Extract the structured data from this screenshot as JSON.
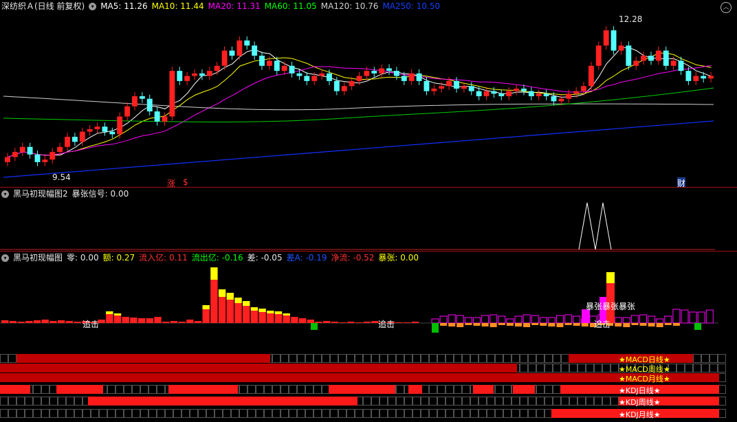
{
  "main": {
    "title": "深纺织Ａ(日线 前复权)",
    "ma": [
      {
        "label": "MA5: 11.26",
        "color": "#ffffff"
      },
      {
        "label": "MA10: 11.44",
        "color": "#ffff00"
      },
      {
        "label": "MA20: 11.31",
        "color": "#ff00ff"
      },
      {
        "label": "MA60: 11.05",
        "color": "#00ff00"
      },
      {
        "label": "MA120: 10.76",
        "color": "#d0d0d0"
      },
      {
        "label": "MA250: 10.50",
        "color": "#1040ff"
      }
    ],
    "high_label": "12.28",
    "low_label": "9.54",
    "markers": {
      "zhang": "涨",
      "dollar": "$",
      "cai": "财"
    }
  },
  "pane2": {
    "title": "黑马初现幅图2",
    "signal": "暴张信号: 0.00"
  },
  "pane3": {
    "title": "黑马初现幅图",
    "items": [
      {
        "label": "零: 0.00",
        "color": "#e8e8e8"
      },
      {
        "label": "额: 0.27",
        "color": "#ffff00"
      },
      {
        "label": "流入亿: 0.11",
        "color": "#ff3030"
      },
      {
        "label": "流出亿: -0.16",
        "color": "#00ff00"
      },
      {
        "label": "差: -0.05",
        "color": "#e8e8e8"
      },
      {
        "label": "差A: -0.19",
        "color": "#2050ff"
      },
      {
        "label": "净流: -0.52",
        "color": "#ff3030"
      },
      {
        "label": "暴张: 0.00",
        "color": "#ffff00"
      }
    ],
    "annotations": [
      "追击",
      "追击",
      "暴张暴张暴张",
      "追击"
    ]
  },
  "status_rows": [
    {
      "label": "★MACD日线★",
      "label_color": "#ffff00"
    },
    {
      "label": "★MACD周线★",
      "label_color": "#ffff00"
    },
    {
      "label": "★MACD月线★",
      "label_color": "#ffff00"
    },
    {
      "label": "★KDJ日线★",
      "label_color": "#ffffff"
    },
    {
      "label": "★KDJ周线★",
      "label_color": "#ffffff"
    },
    {
      "label": "★KDJ月线★",
      "label_color": "#ffffff"
    }
  ],
  "colors": {
    "up": "#ff2020",
    "down": "#54ffff",
    "bar_red": "#ff2020",
    "bar_yellow": "#ffff00",
    "magenta": "#ff00ff"
  }
}
